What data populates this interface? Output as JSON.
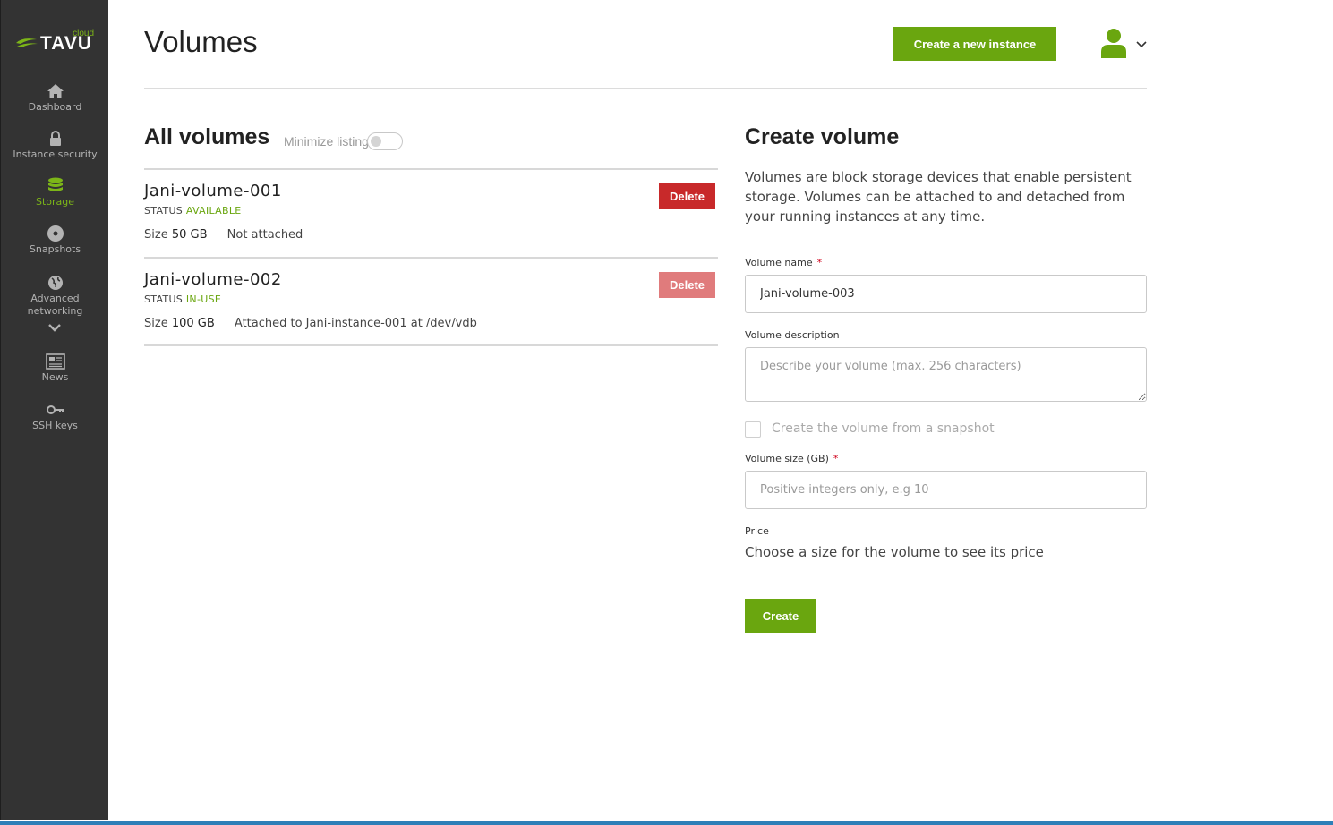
{
  "brand": {
    "name": "TAVU",
    "suffix": "cloud",
    "accent": "#7cb518"
  },
  "sidebar": {
    "items": [
      {
        "label": "Dashboard",
        "icon": "home-icon",
        "active": false
      },
      {
        "label": "Instance security",
        "icon": "lock-icon",
        "active": false
      },
      {
        "label": "Storage",
        "icon": "database-icon",
        "active": true
      },
      {
        "label": "Snapshots",
        "icon": "disc-icon",
        "active": false
      },
      {
        "label": "Advanced networking",
        "icon": "globe-icon",
        "active": false
      },
      {
        "label": "News",
        "icon": "newspaper-icon",
        "active": false
      },
      {
        "label": "SSH keys",
        "icon": "key-icon",
        "active": false
      }
    ]
  },
  "header": {
    "title": "Volumes",
    "new_instance_label": "Create a new instance"
  },
  "listing": {
    "title": "All volumes",
    "minimize_label": "Minimize listing",
    "volumes": [
      {
        "name": "Jani-volume-001",
        "status_label": "STATUS",
        "status": "AVAILABLE",
        "size_label": "Size",
        "size": "50 GB",
        "attachment": "Not attached",
        "delete_label": "Delete"
      },
      {
        "name": "Jani-volume-002",
        "status_label": "STATUS",
        "status": "IN-USE",
        "size_label": "Size",
        "size": "100 GB",
        "attachment": "Attached to Jani-instance-001 at /dev/vdb",
        "delete_label": "Delete"
      }
    ]
  },
  "create": {
    "title": "Create volume",
    "description": "Volumes are block storage devices that enable persistent storage. Volumes can be attached to and detached from your running instances at any time.",
    "name_label": "Volume name",
    "name_value": "Jani-volume-003",
    "desc_label": "Volume description",
    "desc_placeholder": "Describe your volume (max. 256 characters)",
    "snapshot_label": "Create the volume from a snapshot",
    "size_label": "Volume size (GB)",
    "size_placeholder": "Positive integers only, e.g 10",
    "price_label": "Price",
    "price_text": "Choose a size for the volume to see its price",
    "required_mark": "*",
    "submit_label": "Create"
  },
  "colors": {
    "primary": "#6aa60f",
    "danger": "#c8292a",
    "danger_disabled": "#e07b7c",
    "sidebar": "#333333"
  }
}
